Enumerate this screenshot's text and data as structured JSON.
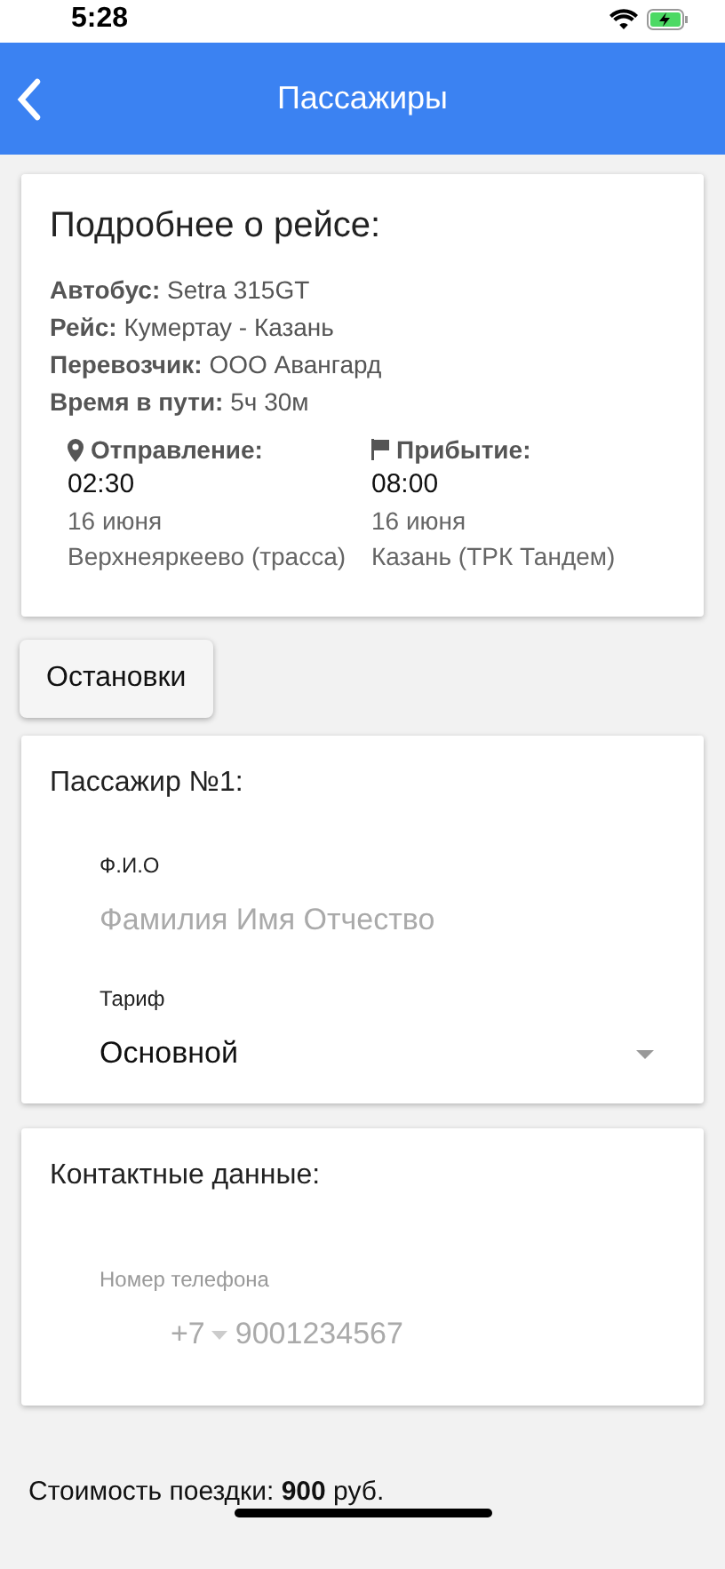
{
  "status_bar": {
    "time": "5:28"
  },
  "header": {
    "title": "Пассажиры"
  },
  "trip": {
    "title": "Подробнее о рейсе:",
    "details": [
      "**Автобус:** Setra 315GT",
      "**Рейс:** Кумертау - Казань",
      "**Перевозчик:** ООО Авангард",
      "**Время в пути:** 5ч 30м"
    ],
    "points": [
      {
        "kind": "departure",
        "label": "Отправление:",
        "time": "02:30",
        "date": "16 июня",
        "place": "Верхнеяркеево (трасса)"
      },
      {
        "kind": "arrival",
        "label": "Прибытие:",
        "time": "08:00",
        "date": "16 июня",
        "place": "Казань (ТРК Тандем)"
      }
    ]
  },
  "stops_button": "Остановки",
  "passenger": {
    "title": "Пассажир №1:",
    "name_field": {
      "label": "Ф.И.О",
      "placeholder": "Фамилия Имя Отчество"
    },
    "tariff_field": {
      "label": "Тариф",
      "value": "Основной"
    }
  },
  "contacts": {
    "title": "Контактные данные:",
    "phone_field": {
      "label": "Номер телефона",
      "country_code": "+7",
      "placeholder": "9001234567"
    }
  },
  "footer": {
    "price": "Стоимость поездки: **900** руб."
  }
}
